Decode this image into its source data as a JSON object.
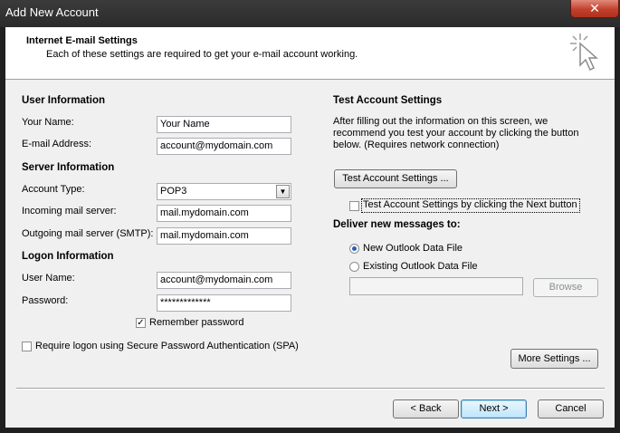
{
  "window": {
    "title": "Add New Account",
    "close_glyph": "✕"
  },
  "header": {
    "title": "Internet E-mail Settings",
    "subtitle": "Each of these settings are required to get your e-mail account working."
  },
  "user_info": {
    "heading": "User Information",
    "name_label": "Your Name:",
    "name_value": "Your Name",
    "email_label": "E-mail Address:",
    "email_value": "account@mydomain.com"
  },
  "server_info": {
    "heading": "Server Information",
    "account_type_label": "Account Type:",
    "account_type_value": "POP3",
    "incoming_label": "Incoming mail server:",
    "incoming_value": "mail.mydomain.com",
    "outgoing_label": "Outgoing mail server (SMTP):",
    "outgoing_value": "mail.mydomain.com"
  },
  "logon_info": {
    "heading": "Logon Information",
    "username_label": "User Name:",
    "username_value": "account@mydomain.com",
    "password_label": "Password:",
    "password_value": "*************",
    "remember_label": "Remember password",
    "remember_checked": true,
    "spa_label": "Require logon using Secure Password Authentication (SPA)",
    "spa_checked": false
  },
  "test_settings": {
    "heading": "Test Account Settings",
    "description": "After filling out the information on this screen, we recommend you test your account by clicking the button below. (Requires network connection)",
    "button_label": "Test Account Settings ...",
    "next_checkbox_label": "Test Account Settings by clicking the Next button",
    "next_checkbox_checked": false
  },
  "deliver": {
    "heading": "Deliver new messages to:",
    "option_new": "New Outlook Data File",
    "option_existing": "Existing Outlook Data File",
    "selected": "new",
    "path_value": "",
    "browse_label": "Browse"
  },
  "buttons": {
    "more_settings": "More Settings ...",
    "back": "< Back",
    "next": "Next >",
    "cancel": "Cancel"
  },
  "colors": {
    "accent": "#3c7fb1",
    "close": "#c2402d"
  }
}
